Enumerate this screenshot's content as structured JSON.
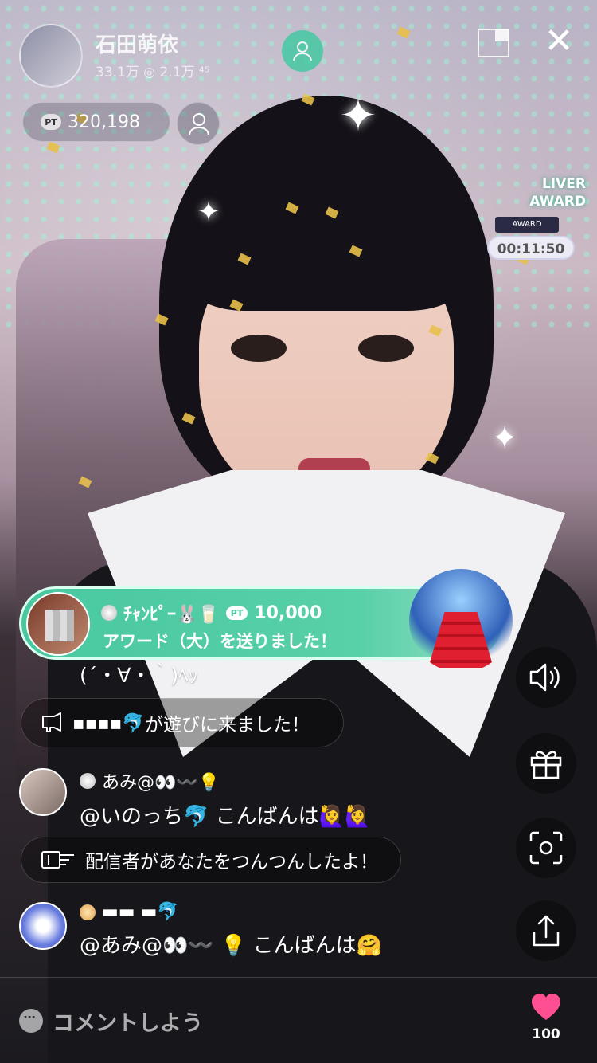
{
  "host": {
    "name": "石田萌依",
    "stats": "33.1万 ◎ 2.1万 ⁴⁵",
    "points": "320,198",
    "points_badge": "PT"
  },
  "award": {
    "title_line1": "LIVER",
    "title_line2": "AWARD",
    "plate": "AWARD",
    "timer": "00:11:50"
  },
  "gift": {
    "sender": "ﾁｬﾝﾋﾟｰ🐰🥛",
    "pt_label": "PT",
    "amount": "10,000",
    "message": "アワード（大）を送りました！"
  },
  "chat": {
    "kaomoji": "(´・∀・｀)ﾍｯ",
    "join_notice": "が遊びに来ました！",
    "join_user": "▪▪▪▪🐬",
    "comments": [
      {
        "user": "あみ@👀〰️💡",
        "text": "@いのっち🐬 こんばんは🙋‍♀️🙋‍♀️"
      },
      {
        "user": "▬▬ ▬🐬",
        "text": "@あみ@👀〰️ 💡 こんばんは🤗"
      }
    ],
    "tsuntsun_notice": "配信者があなたをつんつんしたよ！"
  },
  "comment_bar": {
    "placeholder": "コメントしよう"
  },
  "likes": {
    "count": "100"
  },
  "colors": {
    "accent_green": "#49c8a0",
    "heart_pink": "#ff4f93"
  }
}
